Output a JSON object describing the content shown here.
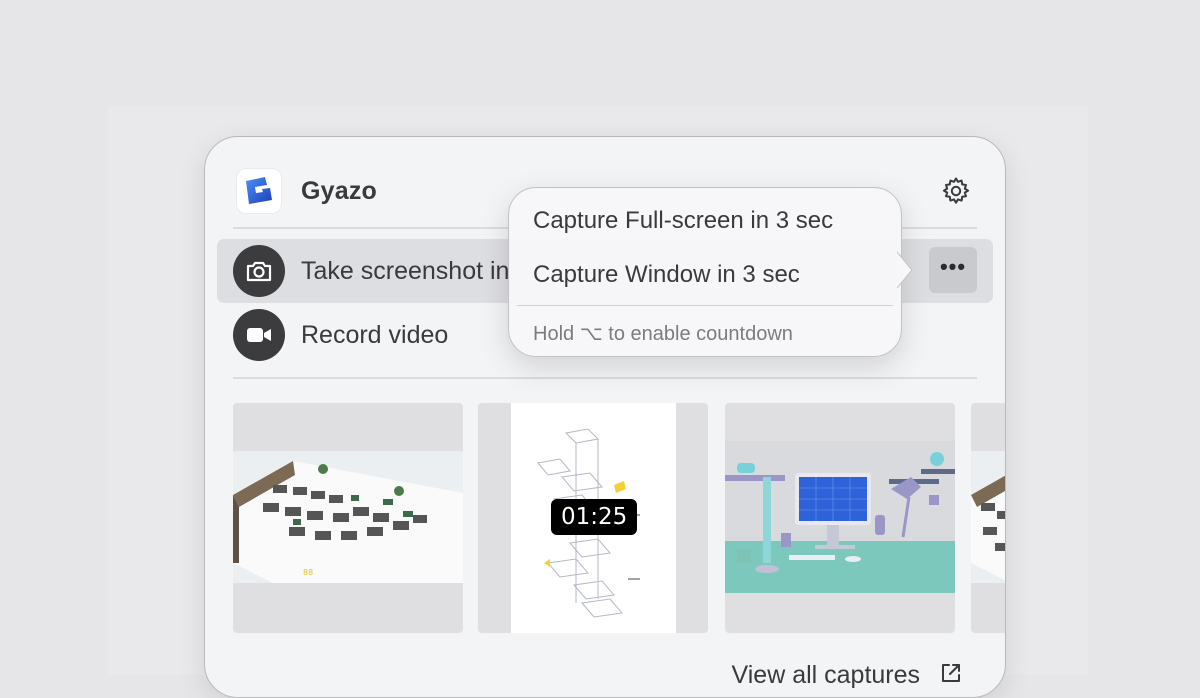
{
  "app": {
    "title": "Gyazo"
  },
  "actions": {
    "screenshot_label": "Take screenshot in",
    "video_label": "Record video",
    "more_label": "•••"
  },
  "thumbnails": [
    {
      "kind": "image",
      "caption": "88"
    },
    {
      "kind": "video",
      "duration": "01:25"
    },
    {
      "kind": "image"
    },
    {
      "kind": "image"
    }
  ],
  "footer": {
    "view_all_label": "View all captures"
  },
  "capture_menu": {
    "items": [
      {
        "label": "Capture Full-screen in 3 sec"
      },
      {
        "label": "Capture Window in 3 sec"
      }
    ],
    "hint": "Hold ⌥ to enable countdown"
  },
  "colors": {
    "panel_bg": "#f3f4f6",
    "icon_circle": "#3c3c3e",
    "logo_blue": "#1f5fd6"
  },
  "icons": {
    "logo": "gyazo-logo-icon",
    "settings": "gear-icon",
    "screenshot": "camera-icon",
    "video": "video-camera-icon",
    "external": "external-link-icon"
  }
}
